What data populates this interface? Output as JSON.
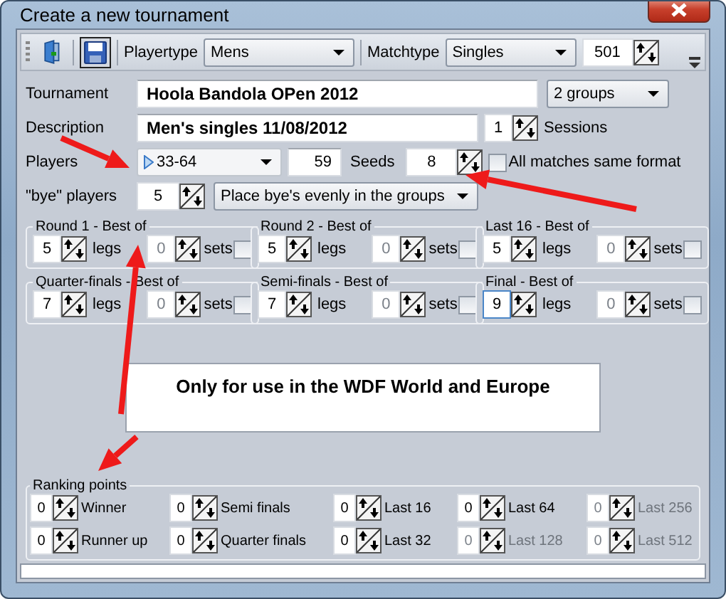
{
  "window": {
    "title": "Create a new tournament"
  },
  "toolbar": {
    "playertype_label": "Playertype",
    "playertype": "Mens",
    "matchtype_label": "Matchtype",
    "matchtype": "Singles",
    "score": "501"
  },
  "tournament": {
    "label": "Tournament",
    "value": "Hoola Bandola OPen 2012",
    "groups": "2 groups"
  },
  "description": {
    "label": "Description",
    "value": "Men's singles 11/08/2012",
    "sessions": "1",
    "sessions_label": "Sessions"
  },
  "players": {
    "label": "Players",
    "range": "33-64",
    "count": "59",
    "seeds_label": "Seeds",
    "seeds": "8",
    "same_format_label": "All matches same format",
    "same_format_checked": false
  },
  "bye": {
    "label": "\"bye\" players",
    "value": "5",
    "placement": "Place bye's evenly in the groups"
  },
  "rounds": [
    {
      "title": "Round 1 - Best of",
      "legs": "5",
      "legs_label": "legs",
      "sets": "0",
      "sets_label": "sets",
      "sets_checked": false,
      "focused": false
    },
    {
      "title": "Round 2 - Best of",
      "legs": "5",
      "legs_label": "legs",
      "sets": "0",
      "sets_label": "sets",
      "sets_checked": false,
      "focused": false
    },
    {
      "title": "Last 16 - Best of",
      "legs": "5",
      "legs_label": "legs",
      "sets": "0",
      "sets_label": "sets",
      "sets_checked": false,
      "focused": false
    },
    {
      "title": "Quarter-finals - Best of",
      "legs": "7",
      "legs_label": "legs",
      "sets": "0",
      "sets_label": "sets",
      "sets_checked": false,
      "focused": false
    },
    {
      "title": "Semi-finals - Best of",
      "legs": "7",
      "legs_label": "legs",
      "sets": "0",
      "sets_label": "sets",
      "sets_checked": false,
      "focused": false
    },
    {
      "title": "Final - Best of",
      "legs": "9",
      "legs_label": "legs",
      "sets": "0",
      "sets_label": "sets",
      "sets_checked": false,
      "focused": true
    }
  ],
  "note": "Only for use in the WDF World and Europe",
  "ranking_points": {
    "title": "Ranking points",
    "items": [
      {
        "value": "0",
        "label": "Winner",
        "disabled": false
      },
      {
        "value": "0",
        "label": "Semi finals",
        "disabled": false
      },
      {
        "value": "0",
        "label": "Last 16",
        "disabled": false
      },
      {
        "value": "0",
        "label": "Last 64",
        "disabled": false
      },
      {
        "value": "0",
        "label": "Last 256",
        "disabled": true
      },
      {
        "value": "0",
        "label": "Runner up",
        "disabled": false
      },
      {
        "value": "0",
        "label": "Quarter finals",
        "disabled": false
      },
      {
        "value": "0",
        "label": "Last 32",
        "disabled": false
      },
      {
        "value": "0",
        "label": "Last 128",
        "disabled": true
      },
      {
        "value": "0",
        "label": "Last 512",
        "disabled": true
      }
    ]
  }
}
